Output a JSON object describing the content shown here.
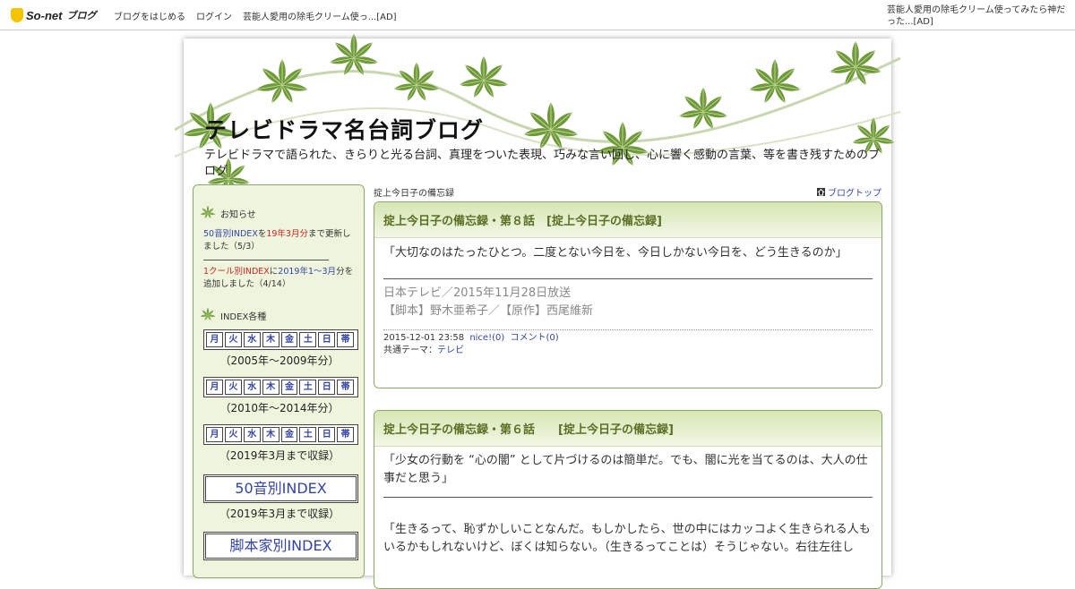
{
  "topbar": {
    "logo_text": "So-net",
    "logo_sub": "ブログ",
    "nav": [
      "ブログをはじめる",
      "ログイン",
      "芸能人愛用の除毛クリーム使っ...[AD]"
    ],
    "ad_right": "芸能人愛用の除毛クリーム使ってみたら神だった...[AD]"
  },
  "blog": {
    "title": "テレビドラマ名台詞ブログ",
    "description": "テレビドラマで語られた、きらりと光る台詞、真理をついた表現、巧みな言い回し、心に響く感動の言葉、等を書き残すためのブログ"
  },
  "sidebar": {
    "notice_heading": "お知らせ",
    "notice1_link": "50音別INDEX",
    "notice1_mid": "を",
    "notice1_red": "19年3月分",
    "notice1_tail": "まで更新しました（5/3）",
    "notice2_red": "1クール別INDEX",
    "notice2_mid": "に",
    "notice2_link": "2019年1～3月",
    "notice2_tail": "分を追加しました（4/14）",
    "index_heading": "INDEX各種",
    "days": [
      "月",
      "火",
      "水",
      "木",
      "金",
      "土",
      "日",
      "帯"
    ],
    "range1": "（2005年～2009年分）",
    "range2": "（2010年～2014年分）",
    "range3": "（2019年3月まで収録）",
    "big1": "50音別INDEX",
    "big1_note": "（2019年3月まで収録）",
    "big2": "脚本家別INDEX"
  },
  "main": {
    "breadcrumb": "掟上今日子の備忘録",
    "blogtop": "ブログトップ",
    "articles": [
      {
        "title": "掟上今日子の備忘録・第８話　[掟上今日子の備忘録]",
        "quote": "「大切なのはたったひとつ。二度とない今日を、今日しかない今日を、どう生きるのか」",
        "broadcast": "日本テレビ／2015年11月28日放送",
        "credits": "【脚本】野木亜希子／【原作】西尾維新",
        "datetime": "2015-12-01 23:58",
        "nice": "nice!(0)",
        "comment": "コメント(0)",
        "theme_label": "共通テーマ：",
        "theme": "テレビ"
      },
      {
        "title": "掟上今日子の備忘録・第６話　　[掟上今日子の備忘録]",
        "quote": "「少女の行動を “心の闇” として片づけるのは簡単だ。でも、闇に光を当てるのは、大人の仕事だと思う」",
        "quote2": "「生きるって、恥ずかしいことなんだ。もしかしたら、世の中にはカッコよく生きられる人もいるかもしれないけど、ぼくは知らない。（生きるってことは）そうじゃない。右往左往し"
      }
    ]
  },
  "colors": {
    "link": "#3344aa",
    "accent_red": "#cc2222",
    "title_green": "#5b6f24",
    "border_green": "#8da864"
  }
}
